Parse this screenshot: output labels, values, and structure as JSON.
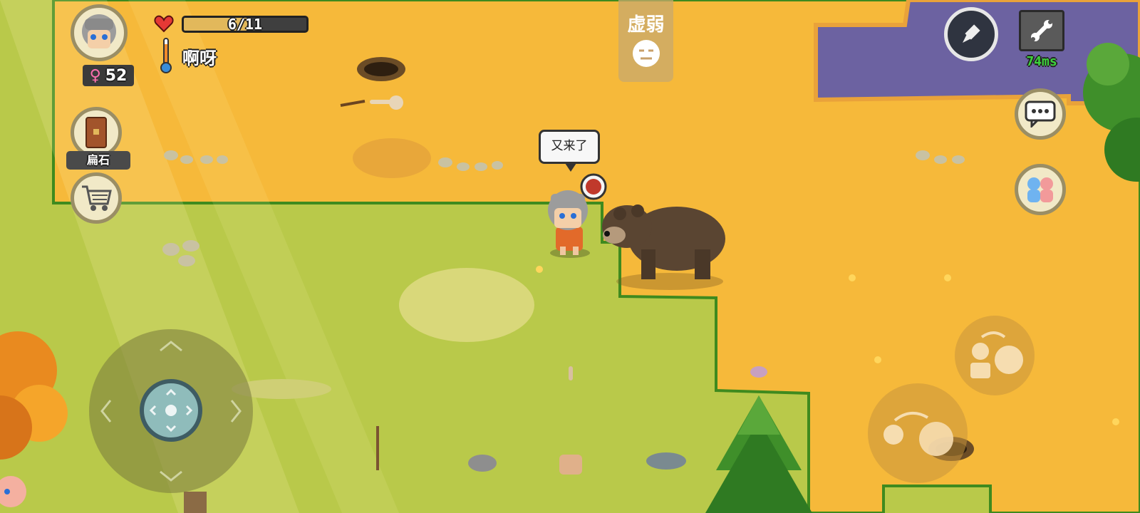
{
  "player": {
    "gender_symbol": "♀",
    "age": "52",
    "health_text": "6/11",
    "health_current": 6,
    "health_max": 11,
    "temperature_label": "啊呀"
  },
  "status": {
    "label": "虚弱"
  },
  "held_item": {
    "label": "扁石"
  },
  "speech": {
    "text": "又来了"
  },
  "network": {
    "ping": "74ms"
  },
  "colors": {
    "grass": "#b9c94a",
    "sand": "#f6b93a",
    "water": "#6c62a1",
    "bear": "#5a4532",
    "ping": "#3cd23c"
  },
  "icons": {
    "heart": "heart-icon",
    "thermometer": "thermometer-icon",
    "weak_face": "weak-face-icon",
    "shop": "shopping-cart-icon",
    "chat": "chat-bubble-icon",
    "family": "family-icon",
    "settings": "wrench-icon",
    "pointer": "pointer-icon"
  }
}
